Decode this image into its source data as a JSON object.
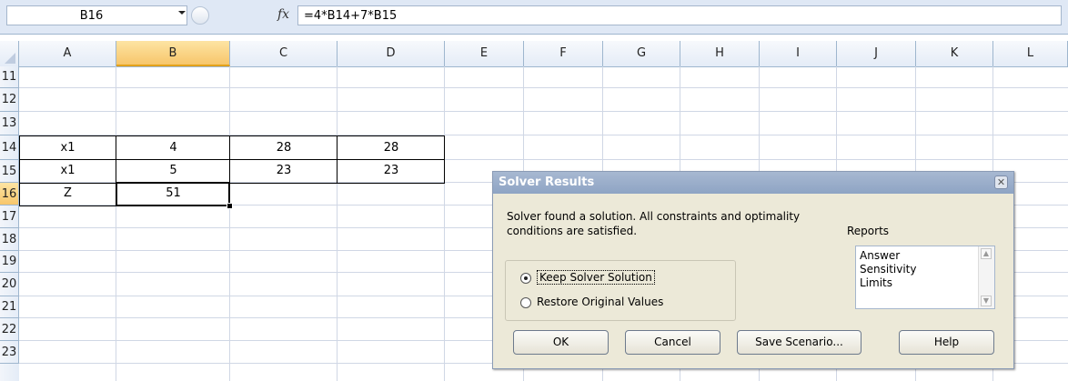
{
  "formula_bar": {
    "name_box": "B16",
    "fx_label": "fx",
    "formula": "=4*B14+7*B15"
  },
  "columns": [
    "A",
    "B",
    "C",
    "D",
    "E",
    "F",
    "G",
    "H",
    "I",
    "J",
    "K",
    "L"
  ],
  "selected_column": "B",
  "rows": [
    "11",
    "12",
    "13",
    "14",
    "15",
    "16",
    "17",
    "18",
    "19",
    "20",
    "21",
    "22",
    "23"
  ],
  "selected_row": "16",
  "cells": {
    "A14": "x1",
    "B14": "4",
    "C14": "28",
    "D14": "28",
    "A15": "x1",
    "B15": "5",
    "C15": "23",
    "D15": "23",
    "A16": "Z",
    "B16": "51"
  },
  "dialog": {
    "title": "Solver Results",
    "close_glyph": "✕",
    "message_line1": "Solver found a solution.  All constraints and optimality",
    "message_line2": "conditions are satisfied.",
    "reports_label": "Reports",
    "reports": [
      "Answer",
      "Sensitivity",
      "Limits"
    ],
    "options": {
      "keep": "Keep Solver Solution",
      "restore": "Restore Original Values",
      "selected": "keep"
    },
    "buttons": {
      "ok": "OK",
      "cancel": "Cancel",
      "save_scenario": "Save Scenario...",
      "help": "Help"
    }
  }
}
